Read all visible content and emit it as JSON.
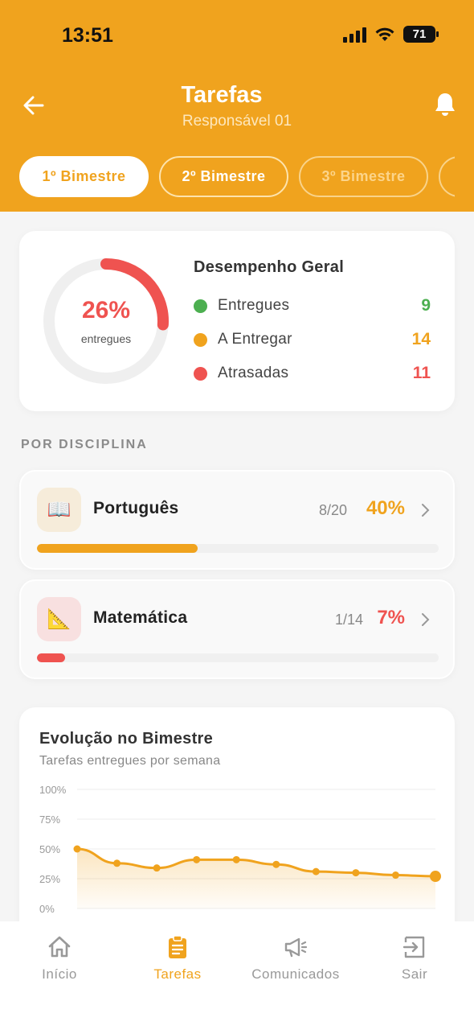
{
  "status_bar": {
    "time": "13:51",
    "battery": "71"
  },
  "header": {
    "title": "Tarefas",
    "subtitle": "Responsável 01"
  },
  "tabs": [
    {
      "label": "1º Bimestre",
      "active": true
    },
    {
      "label": "2º Bimestre",
      "active": false
    },
    {
      "label": "3º Bimestre",
      "active": false
    }
  ],
  "summary": {
    "percent": "26%",
    "percent_value": 26,
    "percent_label": "entregues",
    "title": "Desempenho Geral",
    "rows": [
      {
        "label": "Entregues",
        "value": "9",
        "color": "#4CAF50"
      },
      {
        "label": "A Entregar",
        "value": "14",
        "color": "#F0A31E"
      },
      {
        "label": "Atrasadas",
        "value": "11",
        "color": "#EF5350"
      }
    ]
  },
  "section_label": "POR DISCIPLINA",
  "subjects": [
    {
      "name": "Português",
      "count": "8/20",
      "percent": "40%",
      "progress": 40,
      "color": "#F0A31E",
      "icon": "book-icon",
      "icon_glyph": "📖",
      "icon_bg": "#f6ecda"
    },
    {
      "name": "Matemática",
      "count": "1/14",
      "percent": "7%",
      "progress": 7,
      "color": "#EF5350",
      "icon": "ruler-triangle-icon",
      "icon_glyph": "📐",
      "icon_bg": "#f8e0e0"
    }
  ],
  "chart": {
    "title": "Evolução no Bimestre",
    "subtitle": "Tarefas entregues por semana"
  },
  "chart_data": {
    "type": "area",
    "title": "Evolução no Bimestre",
    "subtitle": "Tarefas entregues por semana",
    "y_ticks": [
      "100%",
      "75%",
      "50%",
      "25%",
      "0%"
    ],
    "ylim": [
      0,
      100
    ],
    "x": [
      1,
      2,
      3,
      4,
      5,
      6,
      7,
      8,
      9,
      10
    ],
    "values": [
      50,
      38,
      34,
      41,
      41,
      37,
      31,
      30,
      28,
      27
    ],
    "color": "#F0A31E",
    "grid": true
  },
  "bottom_nav": [
    {
      "label": "Início",
      "icon": "home-icon",
      "active": false
    },
    {
      "label": "Tarefas",
      "icon": "clipboard-icon",
      "active": true
    },
    {
      "label": "Comunicados",
      "icon": "megaphone-icon",
      "active": false
    },
    {
      "label": "Sair",
      "icon": "logout-icon",
      "active": false
    }
  ]
}
